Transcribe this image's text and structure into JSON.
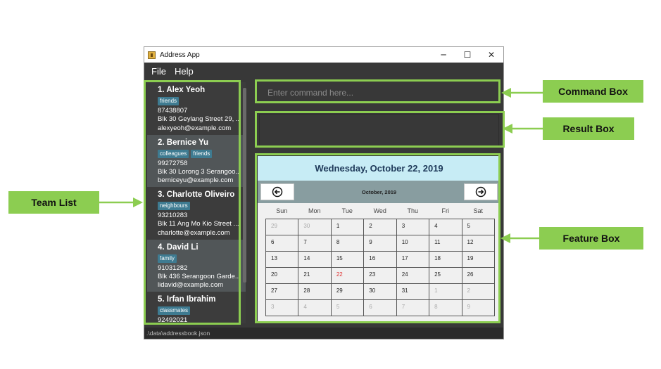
{
  "window": {
    "title": "Address App",
    "minimize": "─",
    "maximize": "☐",
    "close": "✕"
  },
  "menu": {
    "file": "File",
    "help": "Help"
  },
  "persons": [
    {
      "name": "1.  Alex Yeoh",
      "tags": [
        "friends"
      ],
      "phone": "87438807",
      "address": "Blk 30 Geylang Street 29, ...",
      "email": "alexyeoh@example.com"
    },
    {
      "name": "2.  Bernice Yu",
      "tags": [
        "colleagues",
        "friends"
      ],
      "phone": "99272758",
      "address": "Blk 30 Lorong 3 Serangoo...",
      "email": "berniceyu@example.com"
    },
    {
      "name": "3.  Charlotte Oliveiro",
      "tags": [
        "neighbours"
      ],
      "phone": "93210283",
      "address": "Blk 11 Ang Mo Kio Street ...",
      "email": "charlotte@example.com"
    },
    {
      "name": "4.  David Li",
      "tags": [
        "family"
      ],
      "phone": "91031282",
      "address": "Blk 436 Serangoon Garde...",
      "email": "lidavid@example.com"
    },
    {
      "name": "5.  Irfan Ibrahim",
      "tags": [
        "classmates"
      ],
      "phone": "92492021",
      "address": "",
      "email": ""
    }
  ],
  "command": {
    "placeholder": "Enter command here..."
  },
  "result": {
    "text": ""
  },
  "calendar": {
    "full_date": "Wednesday, October 22, 2019",
    "month_label": "October, 2019",
    "weekdays": [
      "Sun",
      "Mon",
      "Tue",
      "Wed",
      "Thu",
      "Fri",
      "Sat"
    ],
    "weeks": [
      [
        {
          "d": "29",
          "o": true
        },
        {
          "d": "30",
          "o": true
        },
        {
          "d": "1"
        },
        {
          "d": "2"
        },
        {
          "d": "3"
        },
        {
          "d": "4"
        },
        {
          "d": "5"
        }
      ],
      [
        {
          "d": "6"
        },
        {
          "d": "7"
        },
        {
          "d": "8"
        },
        {
          "d": "9"
        },
        {
          "d": "10"
        },
        {
          "d": "11"
        },
        {
          "d": "12"
        }
      ],
      [
        {
          "d": "13"
        },
        {
          "d": "14"
        },
        {
          "d": "15"
        },
        {
          "d": "16"
        },
        {
          "d": "17"
        },
        {
          "d": "18"
        },
        {
          "d": "19"
        }
      ],
      [
        {
          "d": "20"
        },
        {
          "d": "21"
        },
        {
          "d": "22",
          "t": true
        },
        {
          "d": "23"
        },
        {
          "d": "24"
        },
        {
          "d": "25"
        },
        {
          "d": "26"
        }
      ],
      [
        {
          "d": "27"
        },
        {
          "d": "28"
        },
        {
          "d": "29"
        },
        {
          "d": "30"
        },
        {
          "d": "31"
        },
        {
          "d": "1",
          "o": true
        },
        {
          "d": "2",
          "o": true
        }
      ],
      [
        {
          "d": "3",
          "o": true
        },
        {
          "d": "4",
          "o": true
        },
        {
          "d": "5",
          "o": true
        },
        {
          "d": "6",
          "o": true
        },
        {
          "d": "7",
          "o": true
        },
        {
          "d": "8",
          "o": true
        },
        {
          "d": "9",
          "o": true
        }
      ]
    ]
  },
  "status": {
    "path": ".\\data\\addressbook.json"
  },
  "annotations": {
    "command_box": "Command Box",
    "result_box": "Result Box",
    "feature_box": "Feature Box",
    "team_list": "Team List"
  },
  "colors": {
    "highlight": "#8ccd51",
    "tag": "#3e7b91",
    "calendar_header": "#c7ecf5",
    "today": "#e03030"
  }
}
